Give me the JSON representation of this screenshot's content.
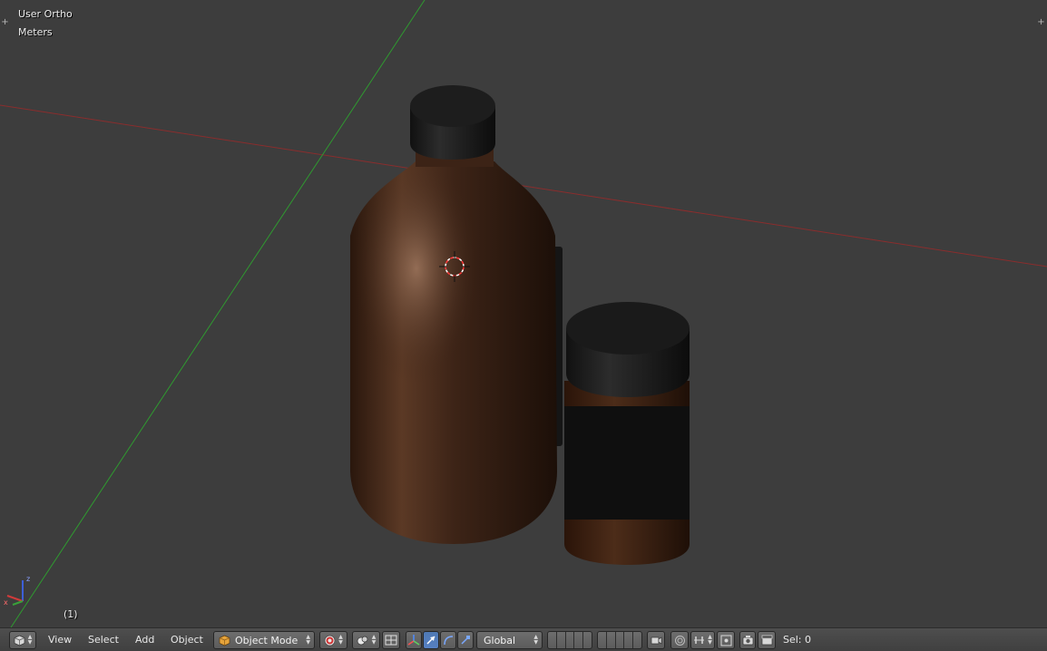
{
  "viewport": {
    "view_name": "User Ortho",
    "units": "Meters",
    "frame": "(1)"
  },
  "header": {
    "menus": [
      "View",
      "Select",
      "Add",
      "Object"
    ],
    "mode": "Object Mode",
    "orientation": "Global",
    "selection": "Sel: 0"
  },
  "colors": {
    "background": "#3d3d3d",
    "x_axis": "#8a2d2d",
    "y_axis": "#2f9a30",
    "z_axis": "#3d5fd8",
    "bottle_glass": "#3a2216",
    "cap": "#1a1a1a",
    "active_button": "#5680c2"
  },
  "icons": {
    "editor": "cube-editor-icon",
    "mode": "object-mode-cube-icon",
    "shading": "viewport-shading-icon",
    "pivot": "pivot-point-icon",
    "manipulator": "manipulator-toggle-icon",
    "translate": "translate-arrow-icon",
    "rotate": "rotate-arc-icon",
    "scale": "scale-icon",
    "proportional": "proportional-editing-icon",
    "snap": "snap-magnet-icon",
    "render": "render-camera-icon"
  }
}
